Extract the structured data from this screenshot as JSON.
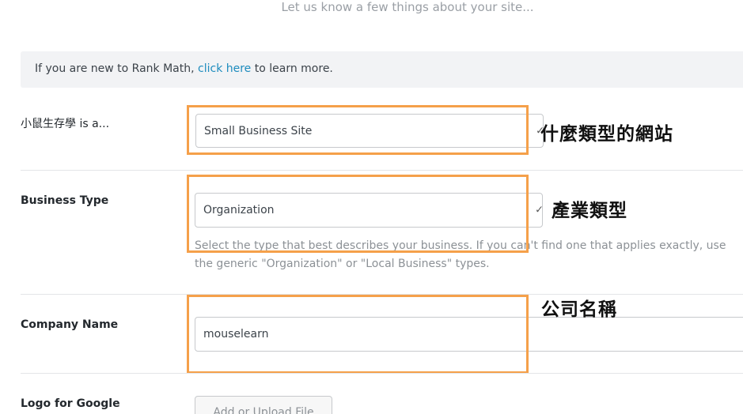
{
  "header": {
    "subtitle": "Let us know a few things about your site..."
  },
  "notice": {
    "prefix": "If you are new to Rank Math, ",
    "link": "click here",
    "suffix": " to learn more."
  },
  "site_type": {
    "label": "小鼠生存學 is a...",
    "value": "Small Business Site"
  },
  "business_type": {
    "label": "Business Type",
    "value": "Organization",
    "help": "Select the type that best describes your business. If you can't find one that applies exactly, use the generic \"Organization\" or \"Local Business\" types."
  },
  "company_name": {
    "label": "Company Name",
    "value": "mouselearn"
  },
  "logo": {
    "label": "Logo for Google",
    "button": "Add or Upload File"
  },
  "annotations": {
    "site_type_note": "什麼類型的網站",
    "business_type_note": "產業類型",
    "company_name_note": "公司名稱",
    "highlight_color": "#f5a04a"
  },
  "icons": {
    "select_arrow": "chevron-down-icon"
  }
}
